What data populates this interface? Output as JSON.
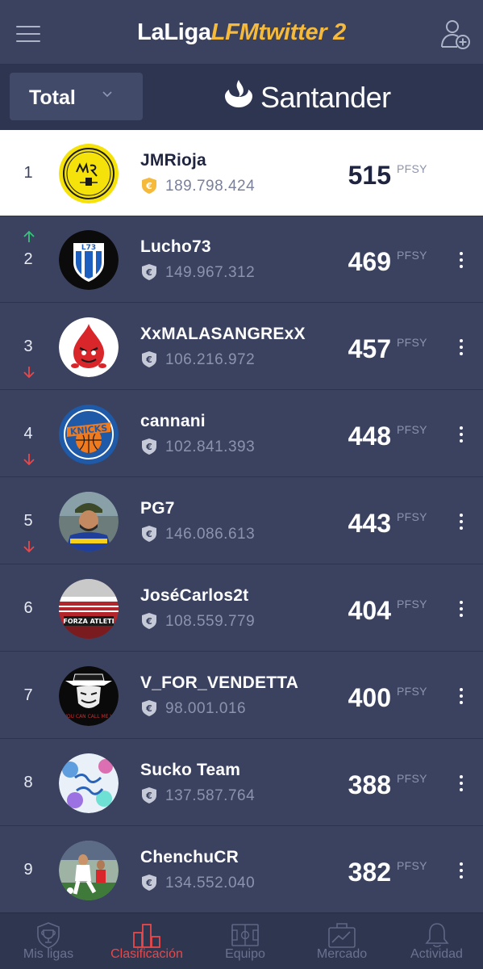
{
  "header": {
    "title_part1": "LaLiga",
    "title_part2": "LFMtwitter 2"
  },
  "subheader": {
    "filter_label": "Total",
    "sponsor": "Santander"
  },
  "colors": {
    "accent_gold": "#f5b93c",
    "up_green": "#36c47a",
    "down_red": "#e8484a",
    "active_nav": "#e8484a"
  },
  "points_unit": "PFSY",
  "standings": [
    {
      "rank": "1",
      "name": "JMRioja",
      "value": "189.798.424",
      "points": "515",
      "trend": "none",
      "leader": true
    },
    {
      "rank": "2",
      "name": "Lucho73",
      "value": "149.967.312",
      "points": "469",
      "trend": "up"
    },
    {
      "rank": "3",
      "name": "XxMALASANGRExX",
      "value": "106.216.972",
      "points": "457",
      "trend": "down"
    },
    {
      "rank": "4",
      "name": "cannani",
      "value": "102.841.393",
      "points": "448",
      "trend": "down"
    },
    {
      "rank": "5",
      "name": "PG7",
      "value": "146.086.613",
      "points": "443",
      "trend": "down"
    },
    {
      "rank": "6",
      "name": "JoséCarlos2t",
      "value": "108.559.779",
      "points": "404",
      "trend": "none"
    },
    {
      "rank": "7",
      "name": "V_FOR_VENDETTA",
      "value": "98.001.016",
      "points": "400",
      "trend": "none"
    },
    {
      "rank": "8",
      "name": "Sucko Team",
      "value": "137.587.764",
      "points": "388",
      "trend": "none"
    },
    {
      "rank": "9",
      "name": "ChenchuCR",
      "value": "134.552.040",
      "points": "382",
      "trend": "none"
    }
  ],
  "nav": [
    {
      "label": "Mis ligas",
      "icon": "trophy-icon"
    },
    {
      "label": "Clasificación",
      "icon": "bar-chart-icon",
      "active": true
    },
    {
      "label": "Equipo",
      "icon": "pitch-icon"
    },
    {
      "label": "Mercado",
      "icon": "briefcase-icon"
    },
    {
      "label": "Actividad",
      "icon": "bell-icon"
    }
  ]
}
